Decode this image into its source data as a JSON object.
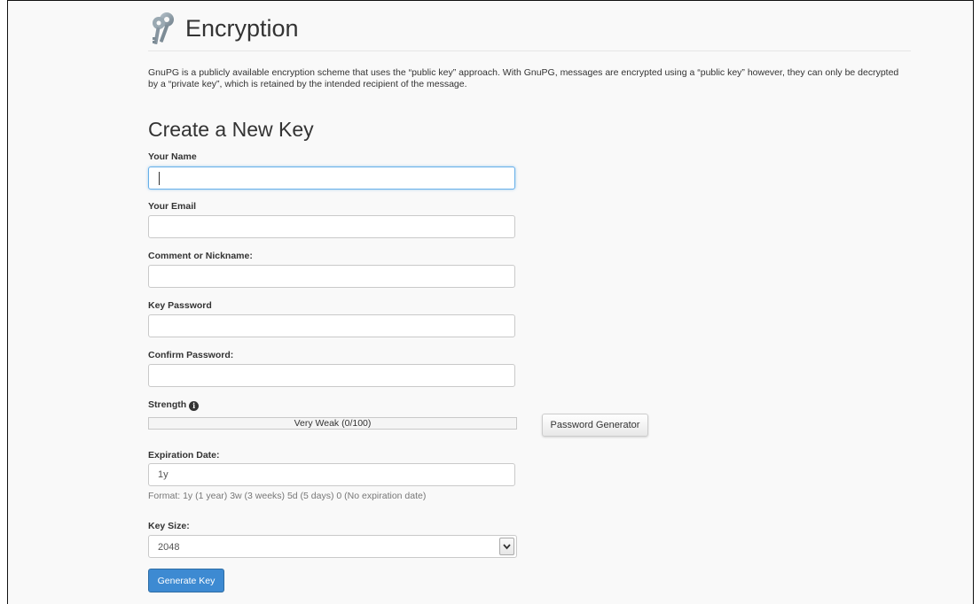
{
  "page": {
    "title": "Encryption",
    "icon": "keys-icon",
    "intro": "GnuPG is a publicly available encryption scheme that uses the “public key” approach. With GnuPG, messages are encrypted using a “public key” however, they can only be decrypted by a “private key”, which is retained by the intended recipient of the message."
  },
  "form": {
    "heading": "Create a New Key",
    "name": {
      "label": "Your Name",
      "value": ""
    },
    "email": {
      "label": "Your Email",
      "value": ""
    },
    "comment": {
      "label": "Comment or Nickname:",
      "value": ""
    },
    "password": {
      "label": "Key Password",
      "value": ""
    },
    "confirm": {
      "label": "Confirm Password:",
      "value": ""
    },
    "strength": {
      "label": "Strength",
      "info_icon": "info-circle-icon",
      "text": "Very Weak (0/100)",
      "score": 0
    },
    "generator_button": "Password Generator",
    "expiration": {
      "label": "Expiration Date:",
      "value": "1y",
      "help": "Format: 1y (1 year) 3w (3 weeks) 5d (5 days) 0 (No expiration date)"
    },
    "key_size": {
      "label": "Key Size:",
      "selected": "2048",
      "arrow_icon": "chevron-down-icon"
    },
    "submit_button": "Generate Key"
  },
  "colors": {
    "primary": "#3d8ad2",
    "focus": "#66afe9",
    "background": "#f9f9f9"
  }
}
